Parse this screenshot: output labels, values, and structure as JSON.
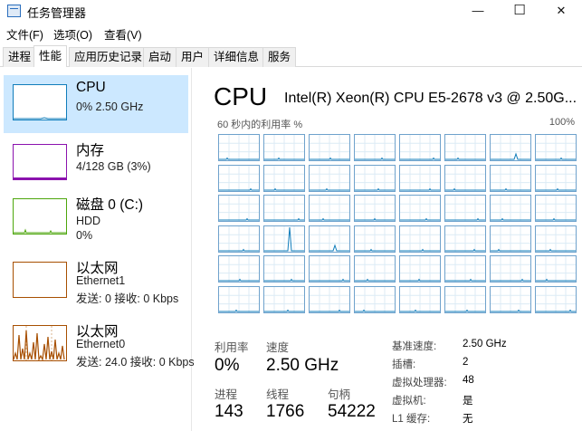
{
  "window": {
    "title": "任务管理器",
    "controls": {
      "minimize": "—",
      "maximize": "☐",
      "close": "✕"
    }
  },
  "menu": [
    "文件(F)",
    "选项(O)",
    "查看(V)"
  ],
  "tabs": [
    {
      "label": "进程",
      "active": false
    },
    {
      "label": "性能",
      "active": true
    },
    {
      "label": "应用历史记录",
      "active": false
    },
    {
      "label": "启动",
      "active": false
    },
    {
      "label": "用户",
      "active": false
    },
    {
      "label": "详细信息",
      "active": false
    },
    {
      "label": "服务",
      "active": false
    }
  ],
  "sidebar": {
    "items": [
      {
        "title": "CPU",
        "lines": [
          "0% 2.50 GHz"
        ],
        "color": "#117dbb",
        "selected": true
      },
      {
        "title": "内存",
        "lines": [
          "4/128 GB (3%)"
        ],
        "color": "#8b12ae",
        "selected": false
      },
      {
        "title": "磁盘 0 (C:)",
        "lines": [
          "HDD",
          "0%"
        ],
        "color": "#4da60c",
        "selected": false
      },
      {
        "title": "以太网",
        "lines": [
          "Ethernet1",
          "发送: 0 接收: 0 Kbps"
        ],
        "color": "#a74f01",
        "selected": false
      },
      {
        "title": "以太网",
        "lines": [
          "Ethernet0",
          "发送: 24.0 接收: 0 Kbps"
        ],
        "color": "#a74f01",
        "selected": false
      }
    ]
  },
  "main": {
    "title": "CPU",
    "model": "Intel(R) Xeon(R) CPU E5-2678 v3 @ 2.50G...",
    "util_label": "60 秒内的利用率 %",
    "util_max": "100%",
    "core_rows": 6,
    "core_cols": 8,
    "stats": {
      "utilization": {
        "label": "利用率",
        "value": "0%"
      },
      "speed": {
        "label": "速度",
        "value": "2.50 GHz"
      },
      "processes": {
        "label": "进程",
        "value": "143"
      },
      "threads": {
        "label": "线程",
        "value": "1766"
      },
      "handles": {
        "label": "句柄",
        "value": "54222"
      }
    },
    "details": [
      {
        "key": "基准速度:",
        "value": "2.50 GHz"
      },
      {
        "key": "插槽:",
        "value": "2"
      },
      {
        "key": "虚拟处理器:",
        "value": "48"
      },
      {
        "key": "虚拟机:",
        "value": "是"
      },
      {
        "key": "L1 缓存:",
        "value": "无"
      }
    ]
  }
}
